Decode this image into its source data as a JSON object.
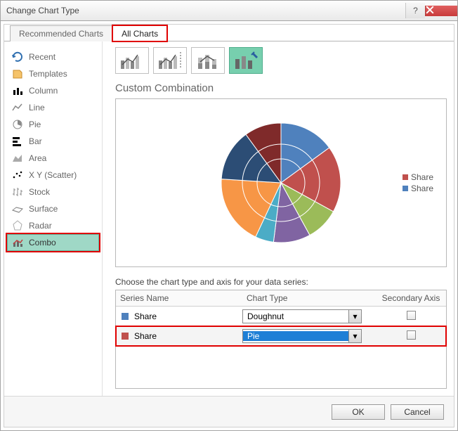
{
  "window": {
    "title": "Change Chart Type"
  },
  "tabs": {
    "recommended": "Recommended Charts",
    "all": "All Charts"
  },
  "sidebar": {
    "items": [
      {
        "label": "Recent"
      },
      {
        "label": "Templates"
      },
      {
        "label": "Column"
      },
      {
        "label": "Line"
      },
      {
        "label": "Pie"
      },
      {
        "label": "Bar"
      },
      {
        "label": "Area"
      },
      {
        "label": "X Y (Scatter)"
      },
      {
        "label": "Stock"
      },
      {
        "label": "Surface"
      },
      {
        "label": "Radar"
      },
      {
        "label": "Combo"
      }
    ]
  },
  "subtype_title": "Custom Combination",
  "legend": {
    "s0": "Share",
    "s1": "Share"
  },
  "series": {
    "title": "Choose the chart type and axis for your data series:",
    "headers": {
      "name": "Series Name",
      "type": "Chart Type",
      "axis": "Secondary Axis"
    },
    "rows": [
      {
        "name": "Share",
        "type": "Doughnut",
        "color": "#4f81bd"
      },
      {
        "name": "Share",
        "type": "Pie",
        "color": "#c0504d"
      }
    ]
  },
  "buttons": {
    "ok": "OK",
    "cancel": "Cancel"
  },
  "chart_data": {
    "type": "pie",
    "title": "",
    "series": [
      {
        "name": "Share",
        "values": [
          15,
          18,
          9,
          10,
          5,
          19,
          14,
          10
        ]
      },
      {
        "name": "Share",
        "values": [
          15,
          18,
          9,
          10,
          5,
          19,
          14,
          10
        ]
      }
    ],
    "colors": [
      "#4f81bd",
      "#c0504d",
      "#9bbb59",
      "#8064a2",
      "#4bacc6",
      "#f79646",
      "#2c4d75",
      "#7f2a2a"
    ]
  }
}
